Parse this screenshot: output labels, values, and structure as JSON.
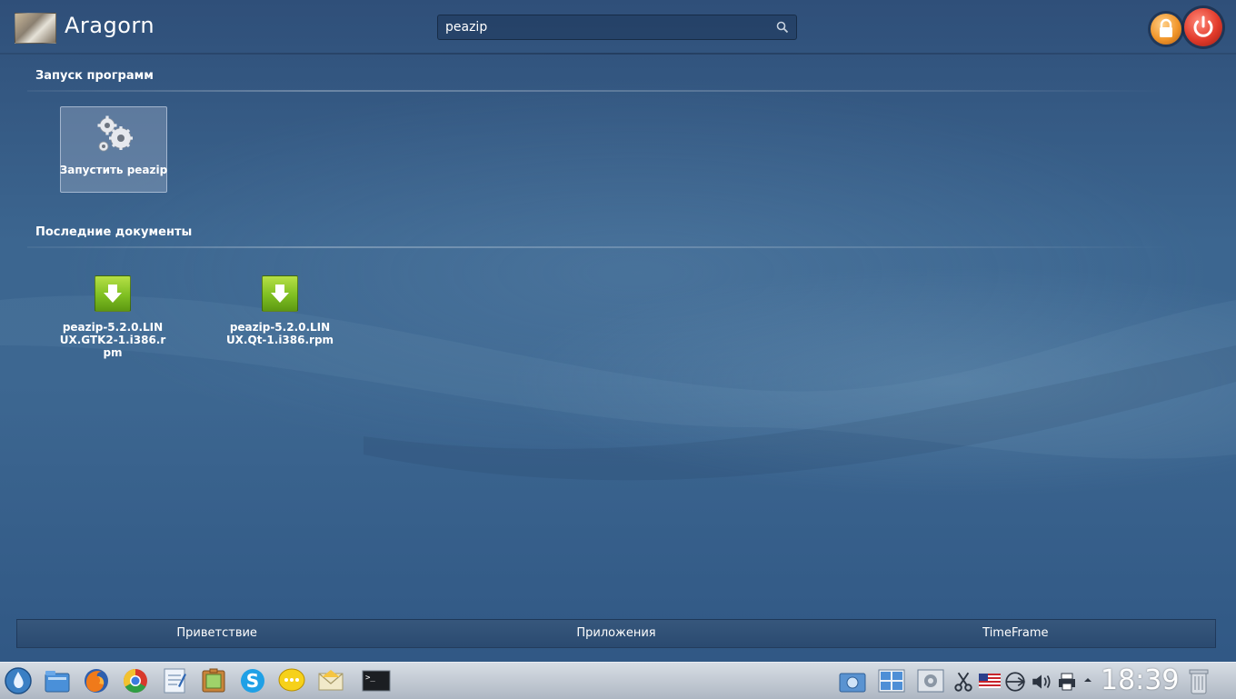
{
  "header": {
    "username": "Aragorn",
    "search_value": "peazip"
  },
  "sections": {
    "launch": {
      "title": "Запуск программ",
      "items": [
        {
          "label": "Запустить peazip",
          "icon": "gears-icon"
        }
      ]
    },
    "recent": {
      "title": "Последние документы",
      "items": [
        {
          "label": "peazip-5.2.0.LINUX.GTK2-1.i386.rpm",
          "icon": "download-arrow-icon"
        },
        {
          "label": "peazip-5.2.0.LINUX.Qt-1.i386.rpm",
          "icon": "download-arrow-icon"
        }
      ]
    }
  },
  "tabs": [
    {
      "label": "Приветствие"
    },
    {
      "label": "Приложения"
    },
    {
      "label": "TimeFrame"
    }
  ],
  "taskbar": {
    "clock": "18:39",
    "launchers": [
      "kde-menu-icon",
      "file-manager-icon",
      "firefox-icon",
      "chrome-icon",
      "text-editor-icon",
      "image-viewer-icon",
      "skype-icon",
      "chat-icon",
      "mail-icon",
      "terminal-icon"
    ],
    "tray": [
      "screenshot-icon",
      "workspace-switcher-icon",
      "system-settings-icon",
      "scissors-icon",
      "keyboard-layout-us-flag-icon",
      "network-icon",
      "volume-icon",
      "printer-icon",
      "tray-expand-icon",
      "trash-icon"
    ]
  },
  "colors": {
    "accent_lock": "#f1962b",
    "accent_power": "#e23b2b",
    "download_green": "#7fbf22"
  }
}
